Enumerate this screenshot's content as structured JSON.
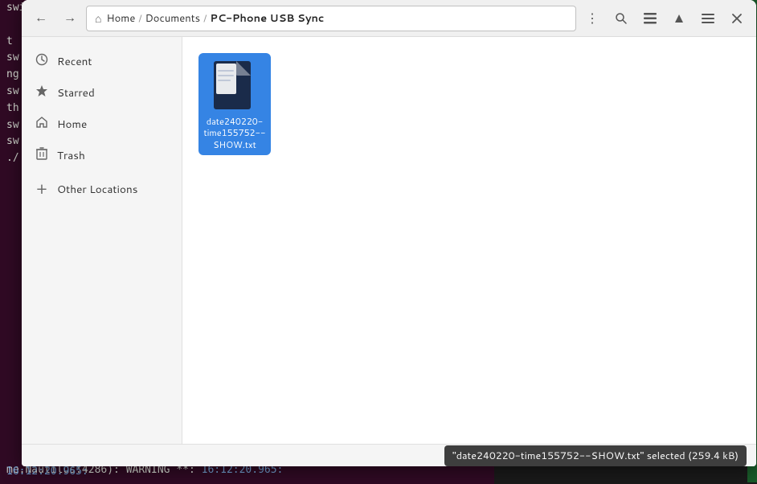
{
  "terminal": {
    "lines": [
      "switch",
      "",
      "t",
      "sw",
      "ng",
      "sw",
      "th",
      "sw",
      "sw",
      "./",
      "me.Nautilus:4286): WARNING **:"
    ],
    "time": "16:12:20.965:"
  },
  "window": {
    "title": "PC-Phone USB Sync"
  },
  "toolbar": {
    "back_label": "←",
    "forward_label": "→",
    "menu_label": "⋮",
    "search_label": "🔍",
    "view_list_label": "≡",
    "view_grid_label": "⊞",
    "hamburger_label": "☰",
    "close_label": "✕"
  },
  "breadcrumb": {
    "home_icon": "⌂",
    "home": "Home",
    "sep1": "/",
    "documents": "Documents",
    "sep2": "/",
    "current": "PC-Phone USB Sync"
  },
  "sidebar": {
    "items": [
      {
        "id": "recent",
        "icon": "🕐",
        "label": "Recent"
      },
      {
        "id": "starred",
        "icon": "★",
        "label": "Starred"
      },
      {
        "id": "home",
        "icon": "⌂",
        "label": "Home"
      },
      {
        "id": "trash",
        "icon": "🗑",
        "label": "Trash"
      },
      {
        "id": "other-locations",
        "icon": "+",
        "label": "Other Locations"
      }
    ]
  },
  "file": {
    "name": "date240220-time155752--SHOW.txt",
    "label": "date240220-\ntime155752--\nSHOW.txt",
    "label_line1": "date240220-",
    "label_line2": "time155752--",
    "label_line3": "SHOW.txt",
    "selected": true
  },
  "status": {
    "text": "\"date240220-time155752--SHOW.txt\" selected (259.4 kB)"
  }
}
